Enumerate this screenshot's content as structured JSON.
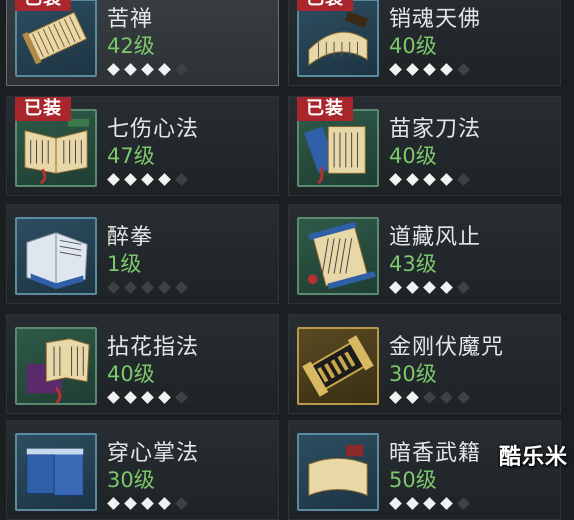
{
  "skills": [
    {
      "id": "kuchan",
      "name": "苦禅",
      "level": "42级",
      "equipped": true,
      "badge": "已装",
      "stars_filled": 4,
      "stars_total": 5,
      "icon": "scroll-bundle-icon",
      "frame": "blue",
      "selected": true
    },
    {
      "id": "xiaohun",
      "name": "销魂天佛",
      "level": "40级",
      "equipped": true,
      "badge": "已装",
      "stars_filled": 4,
      "stars_total": 5,
      "icon": "open-scroll-icon",
      "frame": "blue"
    },
    {
      "id": "qishang",
      "name": "七伤心法",
      "level": "47级",
      "equipped": true,
      "badge": "已装",
      "stars_filled": 4,
      "stars_total": 5,
      "icon": "open-book-icon",
      "frame": "green"
    },
    {
      "id": "miaojia",
      "name": "苗家刀法",
      "level": "40级",
      "equipped": true,
      "badge": "已装",
      "stars_filled": 4,
      "stars_total": 5,
      "icon": "blue-book-icon",
      "frame": "green"
    },
    {
      "id": "zuiquan",
      "name": "醉拳",
      "level": "1级",
      "equipped": false,
      "badge": "",
      "stars_filled": 0,
      "stars_total": 5,
      "icon": "white-book-icon",
      "frame": "blue"
    },
    {
      "id": "daozang",
      "name": "道藏风止",
      "level": "43级",
      "equipped": false,
      "badge": "",
      "stars_filled": 4,
      "stars_total": 5,
      "icon": "scroll-tassel-icon",
      "frame": "green"
    },
    {
      "id": "nianhua",
      "name": "拈花指法",
      "level": "40级",
      "equipped": false,
      "badge": "",
      "stars_filled": 4,
      "stars_total": 5,
      "icon": "purple-book-icon",
      "frame": "green"
    },
    {
      "id": "jingang",
      "name": "金刚伏魔咒",
      "level": "30级",
      "equipped": false,
      "badge": "",
      "stars_filled": 2,
      "stars_total": 5,
      "icon": "gold-scroll-icon",
      "frame": "gold"
    },
    {
      "id": "chuanxin",
      "name": "穿心掌法",
      "level": "30级",
      "equipped": false,
      "badge": "",
      "stars_filled": 4,
      "stars_total": 5,
      "icon": "blue-bundle-icon",
      "frame": "blue"
    },
    {
      "id": "anxiang",
      "name": "暗香武籍",
      "level": "50级",
      "equipped": false,
      "badge": "",
      "stars_filled": 4,
      "stars_total": 5,
      "icon": "old-scroll-icon",
      "frame": "blue"
    }
  ],
  "watermark": "酷乐米",
  "colors": {
    "level": "#7cc86c",
    "badge": "#a8262c",
    "star_on": "#f2f2f2",
    "star_off": "#3c4246"
  }
}
